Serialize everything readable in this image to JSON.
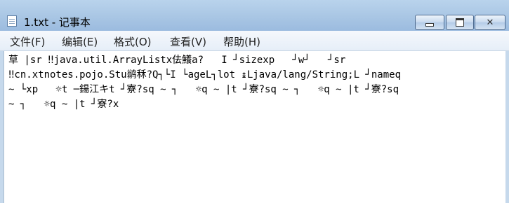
{
  "window": {
    "title": "1.txt - 记事本"
  },
  "menu": {
    "file": "文件(F)",
    "edit": "编辑(E)",
    "format": "格式(O)",
    "view": "查看(V)",
    "help": "帮助(H)"
  },
  "editor": {
    "lines": [
      "草 |sr ‼java.util.ArrayListx佉鱶a?   I ┘sizexp   ┘w┘   ┘sr",
      "‼cn.xtnotes.pojo.Stu鹟秝?Q┐└I └ageL┐lot ↨Ljava/lang/String;L ┘nameq",
      "~ └xp   ☼t ─鍚江キt ┘寮?sq ~ ┐   ☼q ~ |t ┘寮?sq ~ ┐   ☼q ~ |t ┘寮?sq",
      "~ ┐   ☼q ~ |t ┘寮?x"
    ]
  },
  "icons": {
    "app": "notepad-icon",
    "minimize": "minimize-icon",
    "maximize": "maximize-icon",
    "close": "close-icon"
  }
}
